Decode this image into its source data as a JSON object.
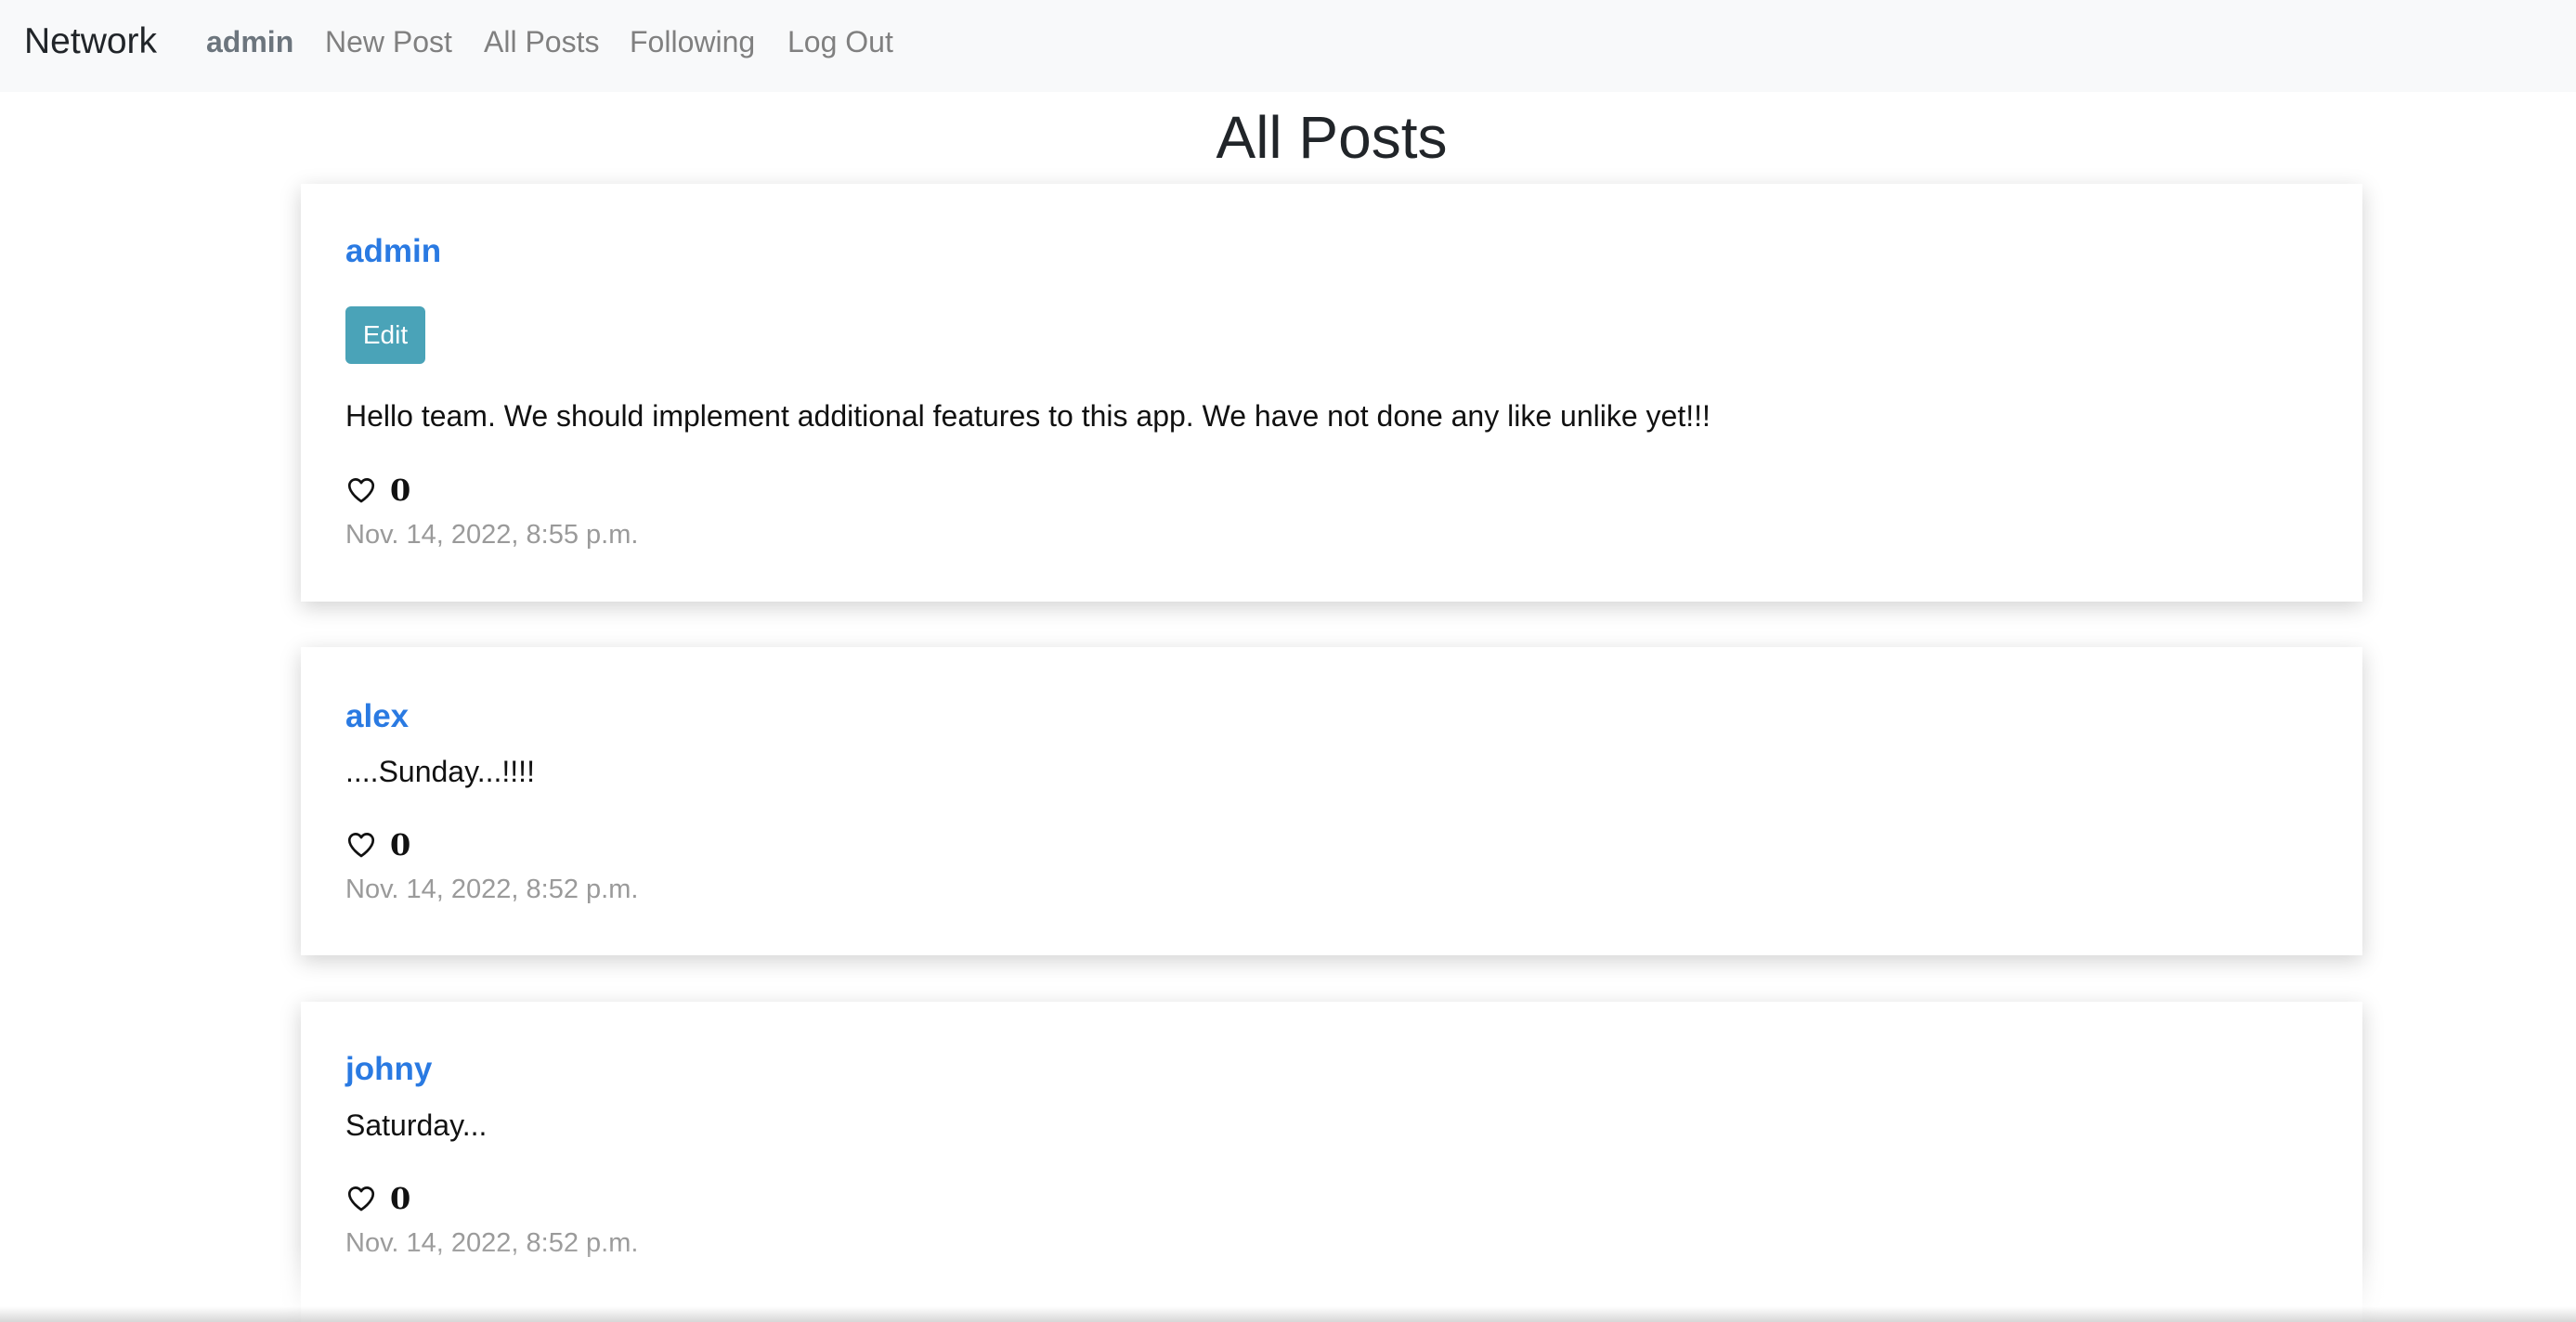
{
  "navbar": {
    "brand": "Network",
    "user": "admin",
    "new_post": "New Post",
    "all_posts": "All Posts",
    "following": "Following",
    "log_out": "Log Out"
  },
  "page": {
    "title": "All Posts"
  },
  "posts": [
    {
      "author": "admin",
      "edit_label": "Edit",
      "content": "Hello team. We should implement additional features to this app. We have not done any like unlike yet!!!",
      "likes": "0",
      "timestamp": "Nov. 14, 2022, 8:55 p.m."
    },
    {
      "author": "alex",
      "content": "....Sunday...!!!!",
      "likes": "0",
      "timestamp": "Nov. 14, 2022, 8:52 p.m."
    },
    {
      "author": "johny",
      "content": "Saturday...",
      "likes": "0",
      "timestamp": "Nov. 14, 2022, 8:52 p.m."
    }
  ],
  "icons": {
    "like": "heart-outline-icon"
  },
  "colors": {
    "author_link": "#2a7ae2",
    "edit_button": "#4aa3b8",
    "navbar_bg": "#f8f9fa",
    "timestamp": "#9a9a9a"
  }
}
